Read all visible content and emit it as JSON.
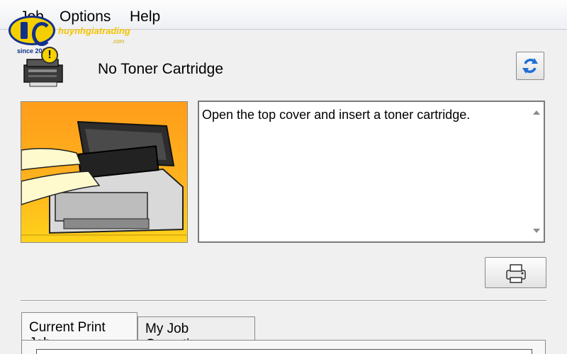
{
  "menu": {
    "items": [
      {
        "label": "Job"
      },
      {
        "label": "Options"
      },
      {
        "label": "Help"
      }
    ]
  },
  "logo": {
    "name": "huynhgiatrading",
    "domain": ".com",
    "since": "since 2013"
  },
  "status": {
    "title": "No Toner Cartridge",
    "message": "Open the top cover and insert a toner cartridge."
  },
  "tabs": [
    {
      "label": "Current Print Job",
      "active": true
    },
    {
      "label": "My Job Operation",
      "active": false
    }
  ],
  "icons": {
    "refresh": "refresh-icon",
    "print": "printer-icon",
    "warning": "warning-icon"
  },
  "colors": {
    "illustration_top": "#ff9d1a",
    "illustration_bottom": "#ffd21a",
    "refresh_blue": "#1f6fd6",
    "logo_blue": "#12308a",
    "logo_yellow": "#f5d000"
  }
}
